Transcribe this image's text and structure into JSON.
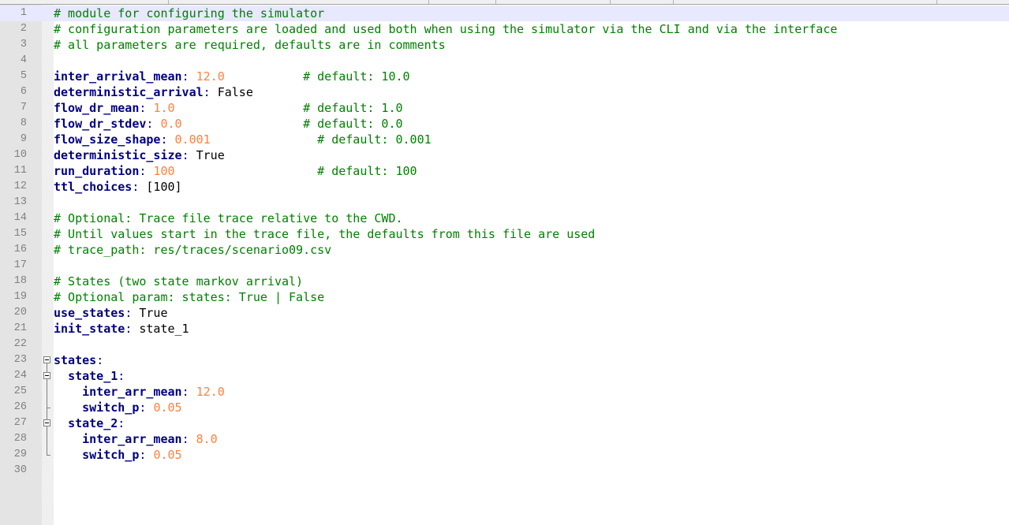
{
  "editor": {
    "lines": [
      {
        "n": "1",
        "current": true,
        "tokens": [
          {
            "t": "comment",
            "v": "# module for configuring the simulator"
          }
        ]
      },
      {
        "n": "2",
        "tokens": [
          {
            "t": "comment",
            "v": "# configuration parameters are loaded and used both when using the simulator via the CLI and via the interface"
          }
        ]
      },
      {
        "n": "3",
        "tokens": [
          {
            "t": "comment",
            "v": "# all parameters are required, defaults are in comments"
          }
        ]
      },
      {
        "n": "4",
        "tokens": []
      },
      {
        "n": "5",
        "tokens": [
          {
            "t": "key",
            "v": "inter_arrival_mean"
          },
          {
            "t": "punct",
            "v": ": "
          },
          {
            "t": "num",
            "v": "12.0"
          },
          {
            "t": "plain",
            "v": "           "
          },
          {
            "t": "comment",
            "v": "# default: 10.0"
          }
        ]
      },
      {
        "n": "6",
        "tokens": [
          {
            "t": "key",
            "v": "deterministic_arrival"
          },
          {
            "t": "punct",
            "v": ": "
          },
          {
            "t": "plain",
            "v": "False"
          }
        ]
      },
      {
        "n": "7",
        "tokens": [
          {
            "t": "key",
            "v": "flow_dr_mean"
          },
          {
            "t": "punct",
            "v": ": "
          },
          {
            "t": "num",
            "v": "1.0"
          },
          {
            "t": "plain",
            "v": "                  "
          },
          {
            "t": "comment",
            "v": "# default: 1.0"
          }
        ]
      },
      {
        "n": "8",
        "tokens": [
          {
            "t": "key",
            "v": "flow_dr_stdev"
          },
          {
            "t": "punct",
            "v": ": "
          },
          {
            "t": "num",
            "v": "0.0"
          },
          {
            "t": "plain",
            "v": "                 "
          },
          {
            "t": "comment",
            "v": "# default: 0.0"
          }
        ]
      },
      {
        "n": "9",
        "tokens": [
          {
            "t": "key",
            "v": "flow_size_shape"
          },
          {
            "t": "punct",
            "v": ": "
          },
          {
            "t": "num",
            "v": "0.001"
          },
          {
            "t": "plain",
            "v": "               "
          },
          {
            "t": "comment",
            "v": "# default: 0.001"
          }
        ]
      },
      {
        "n": "10",
        "tokens": [
          {
            "t": "key",
            "v": "deterministic_size"
          },
          {
            "t": "punct",
            "v": ": "
          },
          {
            "t": "plain",
            "v": "True"
          }
        ]
      },
      {
        "n": "11",
        "tokens": [
          {
            "t": "key",
            "v": "run_duration"
          },
          {
            "t": "punct",
            "v": ": "
          },
          {
            "t": "num",
            "v": "100"
          },
          {
            "t": "plain",
            "v": "                    "
          },
          {
            "t": "comment",
            "v": "# default: 100"
          }
        ]
      },
      {
        "n": "12",
        "tokens": [
          {
            "t": "key",
            "v": "ttl_choices"
          },
          {
            "t": "punct",
            "v": ": "
          },
          {
            "t": "plain",
            "v": "[100]"
          }
        ]
      },
      {
        "n": "13",
        "tokens": []
      },
      {
        "n": "14",
        "tokens": [
          {
            "t": "comment",
            "v": "# Optional: Trace file trace relative to the CWD."
          }
        ]
      },
      {
        "n": "15",
        "tokens": [
          {
            "t": "comment",
            "v": "# Until values start in the trace file, the defaults from this file are used"
          }
        ]
      },
      {
        "n": "16",
        "tokens": [
          {
            "t": "comment",
            "v": "# trace_path: res/traces/scenario09.csv"
          }
        ]
      },
      {
        "n": "17",
        "tokens": []
      },
      {
        "n": "18",
        "tokens": [
          {
            "t": "comment",
            "v": "# States (two state markov arrival)"
          }
        ]
      },
      {
        "n": "19",
        "tokens": [
          {
            "t": "comment",
            "v": "# Optional param: states: True | False"
          }
        ]
      },
      {
        "n": "20",
        "tokens": [
          {
            "t": "key",
            "v": "use_states"
          },
          {
            "t": "punct",
            "v": ": "
          },
          {
            "t": "plain",
            "v": "True"
          }
        ]
      },
      {
        "n": "21",
        "tokens": [
          {
            "t": "key",
            "v": "init_state"
          },
          {
            "t": "punct",
            "v": ": "
          },
          {
            "t": "plain",
            "v": "state_1"
          }
        ]
      },
      {
        "n": "22",
        "tokens": []
      },
      {
        "n": "23",
        "fold": "box",
        "tokens": [
          {
            "t": "key",
            "v": "states"
          },
          {
            "t": "punct",
            "v": ":"
          }
        ]
      },
      {
        "n": "24",
        "fold": "box",
        "tokens": [
          {
            "t": "plain",
            "v": "  "
          },
          {
            "t": "key",
            "v": "state_1"
          },
          {
            "t": "punct",
            "v": ":"
          }
        ]
      },
      {
        "n": "25",
        "fold": "line",
        "tokens": [
          {
            "t": "plain",
            "v": "    "
          },
          {
            "t": "key",
            "v": "inter_arr_mean"
          },
          {
            "t": "punct",
            "v": ": "
          },
          {
            "t": "num",
            "v": "12.0"
          }
        ]
      },
      {
        "n": "26",
        "fold": "tick",
        "tokens": [
          {
            "t": "plain",
            "v": "    "
          },
          {
            "t": "key",
            "v": "switch_p"
          },
          {
            "t": "punct",
            "v": ": "
          },
          {
            "t": "num",
            "v": "0.05"
          }
        ]
      },
      {
        "n": "27",
        "fold": "box",
        "tokens": [
          {
            "t": "plain",
            "v": "  "
          },
          {
            "t": "key",
            "v": "state_2"
          },
          {
            "t": "punct",
            "v": ":"
          }
        ]
      },
      {
        "n": "28",
        "fold": "line",
        "tokens": [
          {
            "t": "plain",
            "v": "    "
          },
          {
            "t": "key",
            "v": "inter_arr_mean"
          },
          {
            "t": "punct",
            "v": ": "
          },
          {
            "t": "num",
            "v": "8.0"
          }
        ]
      },
      {
        "n": "29",
        "fold": "end",
        "tokens": [
          {
            "t": "plain",
            "v": "    "
          },
          {
            "t": "key",
            "v": "switch_p"
          },
          {
            "t": "punct",
            "v": ": "
          },
          {
            "t": "num",
            "v": "0.05"
          }
        ]
      },
      {
        "n": "30",
        "tokens": []
      }
    ]
  },
  "colors": {
    "comment": "#008000",
    "key": "#000080",
    "number": "#ff8040",
    "current_line": "#e8e8ff",
    "gutter": "#e4e4e4",
    "line_number": "#808080"
  }
}
